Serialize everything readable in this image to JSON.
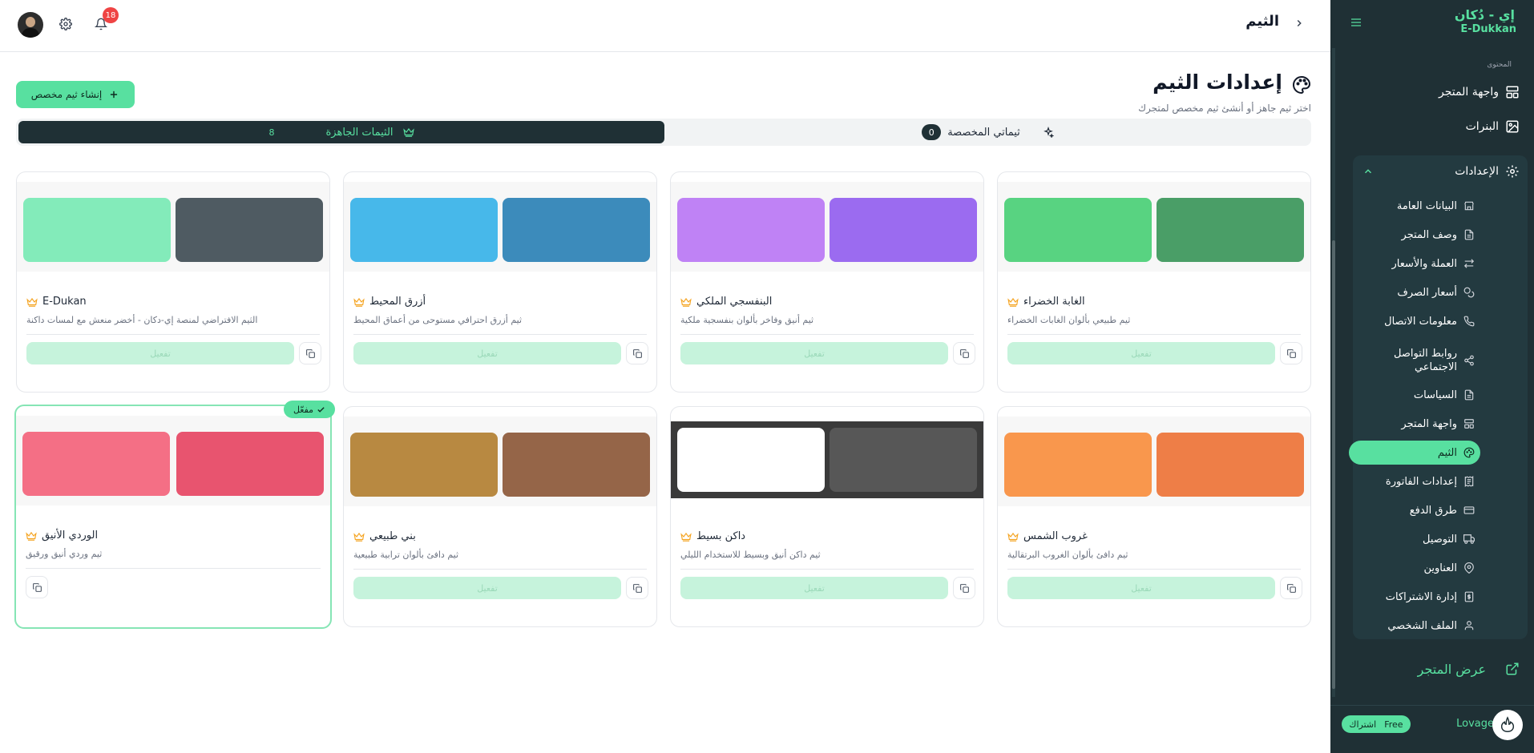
{
  "header": {
    "title": "الثيم",
    "notification_count": "18"
  },
  "page": {
    "title": "إعدادات الثيم",
    "subtitle": "اختر ثيم جاهز أو أنشئ ثيم مخصص لمتجرك",
    "create_button": "إنشاء ثيم مخصص"
  },
  "tabs": {
    "ready": {
      "label": "الثيمات الجاهزة",
      "count": "8"
    },
    "custom": {
      "label": "ثيماتي المخصصة",
      "count": "0"
    }
  },
  "themes": [
    {
      "name": "الغابة الخضراء",
      "desc": "ثيم طبيعي بألوان الغابات الخضراء",
      "colors": [
        "#4a9e67",
        "#58d381"
      ],
      "action": "تفعيل"
    },
    {
      "name": "البنفسجي الملكي",
      "desc": "ثيم أنيق وفاخر بألوان بنفسجية ملكية",
      "colors": [
        "#9b6bf0",
        "#bf82f5"
      ],
      "action": "تفعيل"
    },
    {
      "name": "أزرق المحيط",
      "desc": "ثيم أزرق احترافي مستوحى من أعماق المحيط",
      "colors": [
        "#3c8bbb",
        "#47b8ea"
      ],
      "action": "تفعيل"
    },
    {
      "name": "E-Dukan",
      "desc": "الثيم الافتراضي لمنصة إي-دكان - أخضر منعش مع لمسات داكنة",
      "colors": [
        "#4f5b62",
        "#83ebba"
      ],
      "action": "تفعيل"
    },
    {
      "name": "غروب الشمس",
      "desc": "ثيم دافئ بألوان الغروب البرتقالية",
      "colors": [
        "#ee7e47",
        "#f9974d"
      ],
      "action": "تفعيل"
    },
    {
      "name": "داكن بسيط",
      "desc": "ثيم داكن أنيق وبسيط للاستخدام الليلي",
      "colors": [
        "#575757",
        "#ffffff"
      ],
      "preview_bg": "#3a3a3a",
      "action": "تفعيل"
    },
    {
      "name": "بني طبيعي",
      "desc": "ثيم دافئ بألوان ترابية طبيعية",
      "colors": [
        "#956548",
        "#b88941"
      ],
      "action": "تفعيل"
    },
    {
      "name": "الوردي الأنيق",
      "desc": "ثيم وردي أنيق ورقيق",
      "colors": [
        "#e8546f",
        "#f46f85"
      ],
      "active": true,
      "active_badge": "مفعّل"
    }
  ],
  "sidebar": {
    "brand_ar": "إي - دُكان",
    "brand_en": "E-Dukkan",
    "section_label": "المحتوى",
    "items": [
      {
        "label": "واجهة المتجر",
        "icon": "layout-icon"
      },
      {
        "label": "البنرات",
        "icon": "image-icon"
      },
      {
        "label": "الإعدادات",
        "icon": "gear-icon"
      }
    ],
    "settings_sub": [
      {
        "label": "البيانات العامة",
        "icon": "store-icon"
      },
      {
        "label": "وصف المتجر",
        "icon": "document-icon"
      },
      {
        "label": "العملة والأسعار",
        "icon": "exchange-icon"
      },
      {
        "label": "أسعار الصرف",
        "icon": "coins-icon"
      },
      {
        "label": "معلومات الاتصال",
        "icon": "phone-icon"
      },
      {
        "label": "روابط التواصل الاجتماعي",
        "icon": "share-icon"
      },
      {
        "label": "السياسات",
        "icon": "document-icon"
      },
      {
        "label": "واجهة المتجر",
        "icon": "layout-icon"
      },
      {
        "label": "الثيم",
        "icon": "palette-icon"
      },
      {
        "label": "إعدادات الفاتورة",
        "icon": "receipt-icon"
      },
      {
        "label": "طرق الدفع",
        "icon": "card-icon"
      },
      {
        "label": "التوصيل",
        "icon": "truck-icon"
      },
      {
        "label": "العناوين",
        "icon": "pin-icon"
      },
      {
        "label": "إدارة الاشتراكات",
        "icon": "dollar-icon"
      },
      {
        "label": "الملف الشخصي",
        "icon": "user-icon"
      }
    ],
    "view_store": "عرض المتجر",
    "user_name": "Lovage",
    "plan_badge": "Free",
    "plan_label": "اشتراك"
  },
  "colors": {
    "accent": "#58e0a0",
    "sidebar_bg": "#1f3035",
    "dark_tab": "#1f3035",
    "badge_red": "#ef4444"
  }
}
